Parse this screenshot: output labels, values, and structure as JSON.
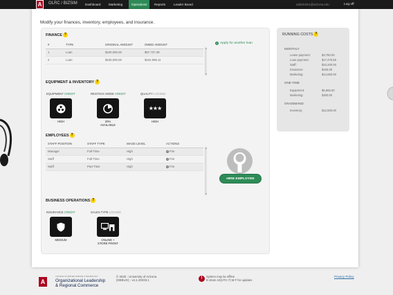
{
  "nav": {
    "brand_left": "OLRC /",
    "brand_right": "BIZSIM",
    "items": [
      {
        "label": "Dashboard"
      },
      {
        "label": "Marketing"
      },
      {
        "label": "Operations"
      },
      {
        "label": "Reports"
      },
      {
        "label": "Leader Board"
      }
    ],
    "active_index": 2,
    "user_email": "sallelrohn1@arizona.edu",
    "logoff_label": "Log off"
  },
  "intro_text": "Modify your finances, inventory, employees, and insurance.",
  "finance": {
    "title": "FINANCE",
    "apply_label": "Apply for another loan",
    "columns": [
      "#",
      "TYPE",
      "ORIGINAL AMOUNT",
      "OWED AMOUNT"
    ],
    "rows": [
      [
        "1",
        "Loan",
        "$100,000.00",
        "$97,737.39"
      ],
      [
        "2",
        "Loan",
        "$100,000.00",
        "$104,995.11"
      ]
    ]
  },
  "equipment": {
    "title": "EQUIPMENT & INVENTORY",
    "items": [
      {
        "label": "EQUIPMENT",
        "tag": "CREDIT",
        "caption": "HIGH",
        "icon": "equipment-icon"
      },
      {
        "label": "RESTOCK MODE",
        "tag": "CREDIT",
        "caption": "20%\nAVAILABLE",
        "icon": "restock-icon"
      },
      {
        "label": "QUALITY",
        "tag": "LOCKED",
        "caption": "HIGH",
        "icon": "quality-stars-icon"
      }
    ]
  },
  "employees": {
    "title": "EMPLOYEES",
    "columns": [
      "STAFF POSITION",
      "STAFF TYPE",
      "WAGE LEVEL",
      "ACTIONS"
    ],
    "rows": [
      [
        "Manager",
        "Full-Time",
        "High",
        "Fire"
      ],
      [
        "Staff",
        "Full-Time",
        "High",
        "Fire"
      ],
      [
        "Staff",
        "Part-Time",
        "High",
        "Fire"
      ]
    ],
    "hire_label": "HIRE EMPLOYEE"
  },
  "business": {
    "title": "BUSINESS OPERATIONS",
    "items": [
      {
        "label": "INSURANCE",
        "tag": "CREDIT",
        "caption": "MEDIUM",
        "icon": "shield-icon"
      },
      {
        "label": "SALES TYPE",
        "tag": "LOCKED",
        "caption": "ONLINE +\nSTORE FRONT",
        "icon": "online-store-icon"
      }
    ]
  },
  "running_costs": {
    "title": "RUNNING COSTS",
    "monthly_label": "MONTHLY",
    "monthly": [
      {
        "label": "Lease payment:",
        "value": "$3,750.00"
      },
      {
        "label": "Loan payment:",
        "value": "$17,475.55"
      },
      {
        "label": "Staff:",
        "value": "$10,200.00"
      },
      {
        "label": "Insurance:",
        "value": "$156.00"
      },
      {
        "label": "Marketing:",
        "value": "$14,550.00"
      }
    ],
    "onetime_label": "ONE-TIME",
    "onetime": [
      {
        "label": "Equipment:",
        "value": "$5,655.00"
      },
      {
        "label": "Marketing:",
        "value": "$300.00"
      }
    ],
    "ondemand_label": "ON-DEMAND",
    "ondemand": [
      {
        "label": "Inventory:",
        "value": "$12,500.00"
      }
    ]
  },
  "footer": {
    "small_text": "COLLEGE OF APPLIED SCIENCE & TECHNOLOGY",
    "org_line1": "Organizational Leadership",
    "org_line2": "& Regional Commerce",
    "copyright_line1": "© 2020 - University of Arizona",
    "copyright_line2": "(DEBUG) - v4.1.20033.1",
    "offline_line1": "System may be offline",
    "offline_line2": "9-10am AZ(UTC-7) M-F for updates",
    "privacy_label": "Privacy Policy"
  },
  "colors": {
    "nav_bg": "#1b1b1b",
    "accent_green": "#2e8b57",
    "help_yellow": "#ffd200",
    "arizona_red": "#ab0520",
    "arizona_navy": "#0c234b"
  }
}
